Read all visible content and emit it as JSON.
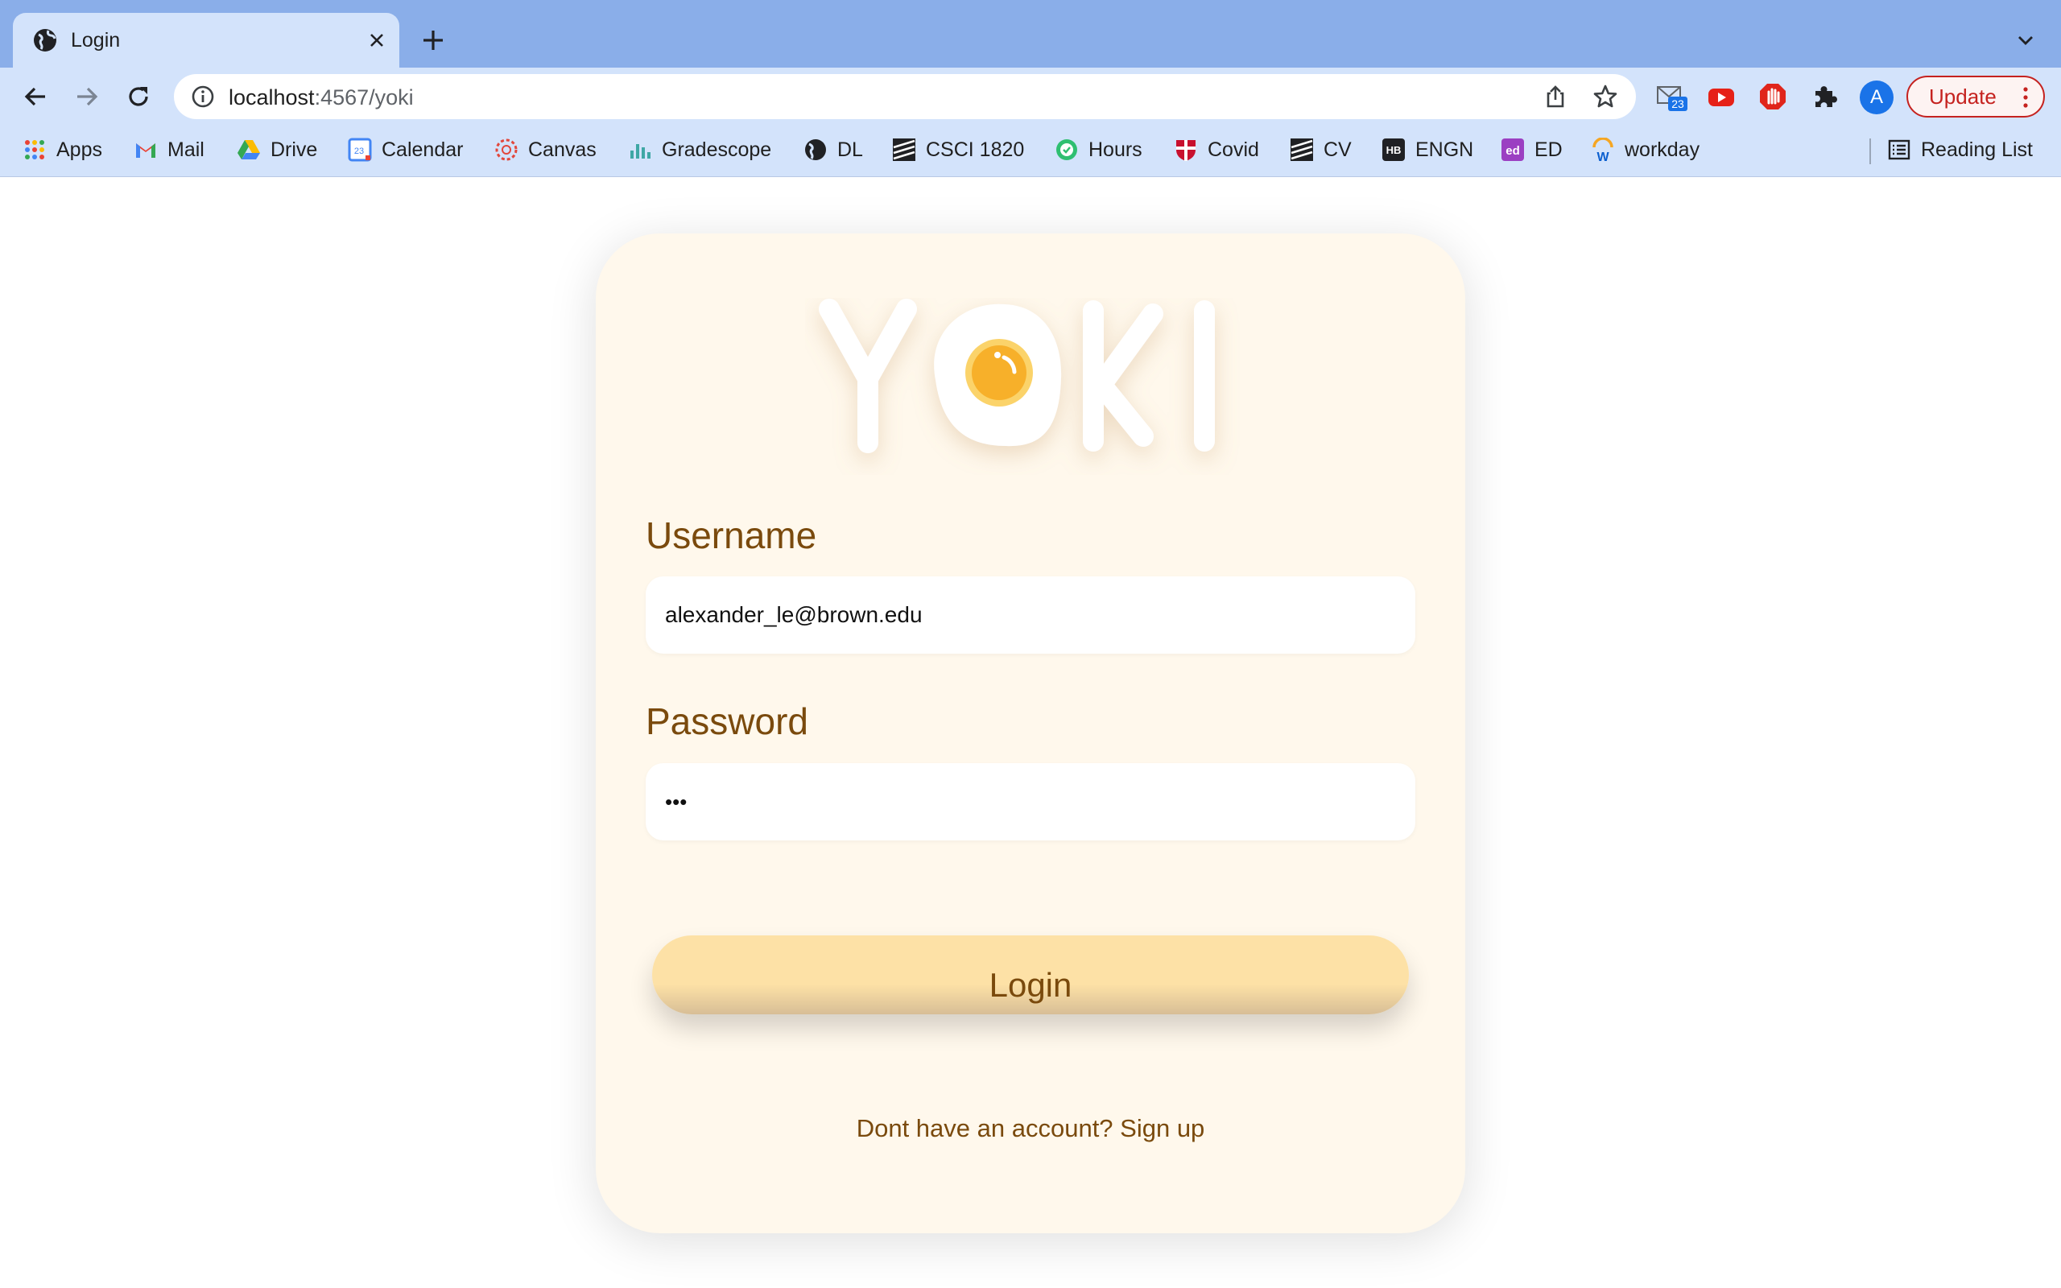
{
  "browser": {
    "tab": {
      "title": "Login"
    },
    "address": {
      "host": "localhost",
      "path": ":4567/yoki"
    },
    "mail_badge": "23",
    "profile_initial": "A",
    "update_label": "Update",
    "bookmarks": [
      {
        "label": "Apps",
        "icon": "apps-grid-icon"
      },
      {
        "label": "Mail",
        "icon": "gmail-icon"
      },
      {
        "label": "Drive",
        "icon": "drive-icon"
      },
      {
        "label": "Calendar",
        "icon": "calendar-icon",
        "icon_text": "23"
      },
      {
        "label": "Canvas",
        "icon": "canvas-icon"
      },
      {
        "label": "Gradescope",
        "icon": "gradescope-icon"
      },
      {
        "label": "DL",
        "icon": "globe-icon"
      },
      {
        "label": "CSCI 1820",
        "icon": "stripes-icon"
      },
      {
        "label": "Hours",
        "icon": "check-circle-icon"
      },
      {
        "label": "Covid",
        "icon": "shield-icon"
      },
      {
        "label": "CV",
        "icon": "stripes-icon"
      },
      {
        "label": "ENGN",
        "icon": "hb-icon",
        "icon_text": "HB"
      },
      {
        "label": "ED",
        "icon": "ed-icon",
        "icon_text": "ed"
      },
      {
        "label": "workday",
        "icon": "workday-icon",
        "icon_text": "W"
      }
    ],
    "reading_list": "Reading List"
  },
  "login": {
    "logo_letters": [
      "Y",
      "K",
      "I"
    ],
    "username_label": "Username",
    "username_value": "alexander_le@brown.edu",
    "password_label": "Password",
    "password_value": "•••",
    "button_label": "Login",
    "signup_text": "Dont have an account? Sign up"
  },
  "colors": {
    "tabbar": "#8aaee9",
    "toolbar": "#d3e3fb",
    "card_bg": "#fff8ec",
    "label_brown": "#7a4a0d",
    "button_top": "#fde1a6",
    "yolk": "#f7b02c",
    "update_red": "#c5221f"
  }
}
